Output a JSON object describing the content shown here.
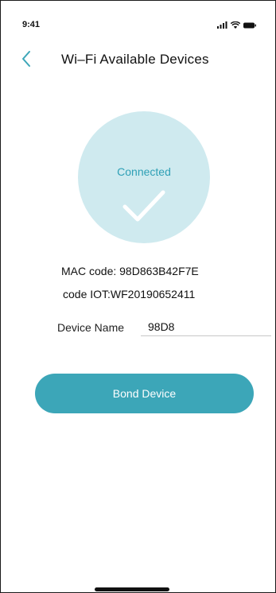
{
  "status_bar": {
    "time": "9:41",
    "icons": [
      "signal-icon",
      "wifi-icon",
      "battery-icon"
    ]
  },
  "header": {
    "back_icon": "chevron-left-icon",
    "title": "Wi–Fi Available Devices"
  },
  "connection": {
    "status": "Connected",
    "icon": "check-icon"
  },
  "device": {
    "mac_line": "MAC code: 98D863B42F7E",
    "iot_line": "code IOT:WF20190652411",
    "name_label": "Device Name",
    "name_value": "98D8"
  },
  "actions": {
    "bond_label": "Bond Device"
  },
  "colors": {
    "accent": "#3ca6b8",
    "circle": "#cfeaef",
    "status_text": "#2fa0b6"
  }
}
